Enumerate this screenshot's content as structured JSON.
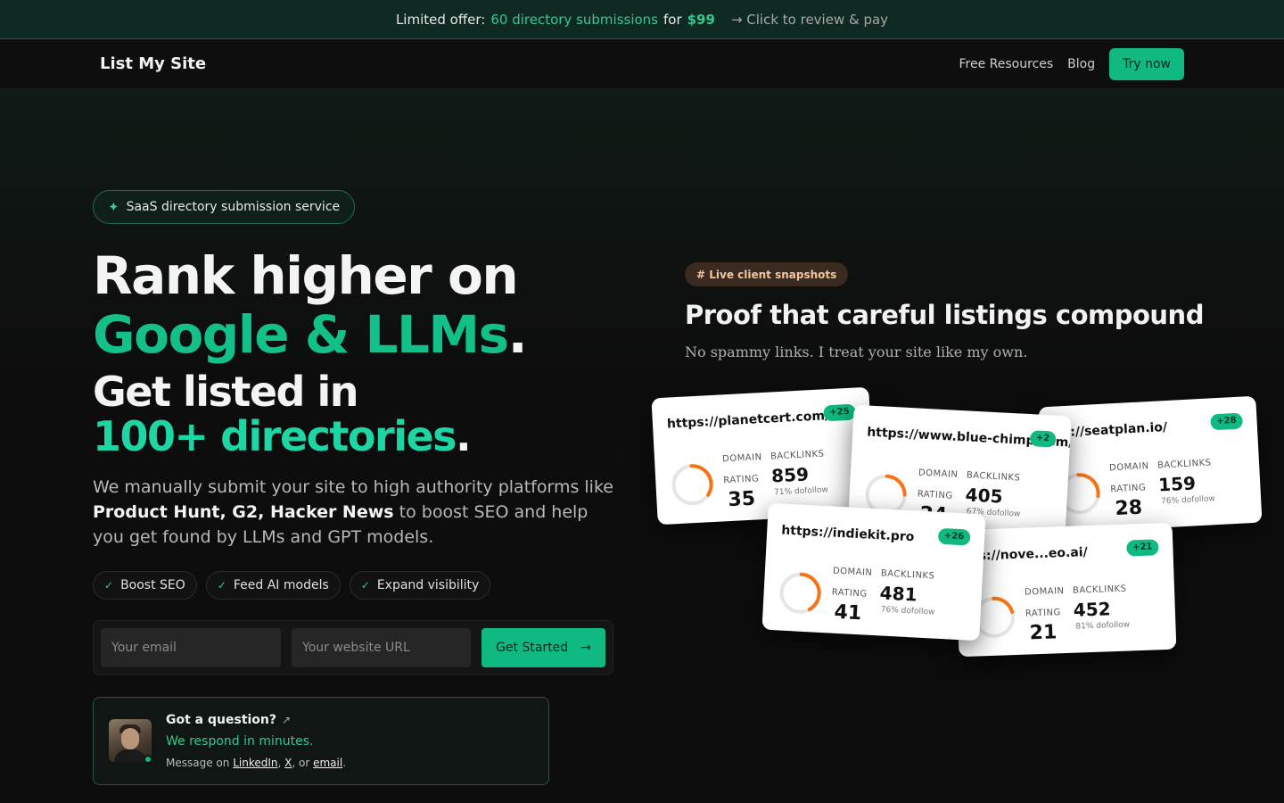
{
  "promo": {
    "prefix": "Limited offer:",
    "highlight": "60 directory submissions",
    "for_word": "for",
    "price": "$99",
    "cta": "→ Click to review & pay"
  },
  "nav": {
    "brand": "List My Site",
    "links": [
      "Free Resources",
      "Blog"
    ],
    "cta": "Try now"
  },
  "hero": {
    "badge": "SaaS directory submission service",
    "line1": "Rank higher on",
    "line2": "Google & LLMs",
    "line3": "Get listed in",
    "line4": "100+ directories",
    "dot": ".",
    "sub_pre": "We manually submit your site to high authority platforms like",
    "sub_bold": "Product Hunt, G2, Hacker News",
    "sub_post": "to boost SEO and help you get found by LLMs and GPT models.",
    "chips": [
      "Boost SEO",
      "Feed AI models",
      "Expand visibility"
    ],
    "email_placeholder": "Your email",
    "url_placeholder": "Your website URL",
    "submit": "Get Started"
  },
  "question": {
    "title": "Got a question?",
    "respond": "We respond in minutes.",
    "msg_pre": "Message on",
    "link1": "LinkedIn",
    "link2": "X",
    "or": "or",
    "link3": "email"
  },
  "proof": {
    "badge": "# Live client snapshots",
    "title": "Proof that careful listings compound",
    "subtitle": "No spammy links. I treat your site like my own.",
    "domain_label": "DOMAIN",
    "rating_label": "RATING",
    "backlinks_label": "BACKLINKS",
    "cards": [
      {
        "url": "https://planetcert.com/",
        "plus": "+25",
        "dr": "35",
        "backlinks": "859",
        "dofollow": "71% dofollow",
        "progress": 0.35
      },
      {
        "url": "ps://seatplan.io/",
        "plus": "+28",
        "dr": "28",
        "backlinks": "159",
        "dofollow": "76% dofollow",
        "progress": 0.28
      },
      {
        "url": "https://www.blue-chimp.com/",
        "plus": "+2",
        "dr": "24",
        "backlinks": "405",
        "dofollow": "67% dofollow",
        "progress": 0.24
      },
      {
        "url": "ps://nove...eo.ai/",
        "plus": "+21",
        "dr": "21",
        "backlinks": "452",
        "dofollow": "81% dofollow",
        "progress": 0.21
      },
      {
        "url": "https://indiekit.pro",
        "plus": "+26",
        "dr": "41",
        "backlinks": "481",
        "dofollow": "76% dofollow",
        "progress": 0.41
      }
    ]
  },
  "colors": {
    "accent": "#10b981",
    "accent_text": "#34c88f",
    "ring": "#f97316"
  }
}
